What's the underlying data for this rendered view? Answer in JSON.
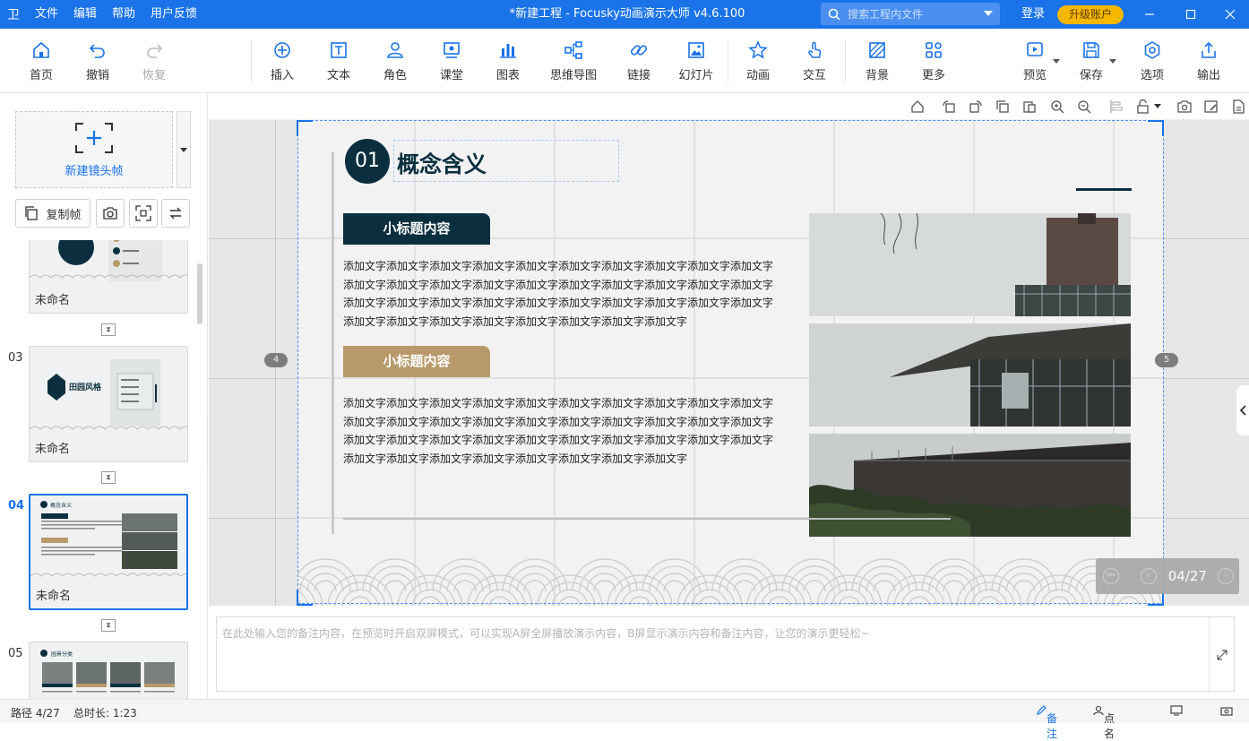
{
  "titlebar": {
    "menus": [
      "文件",
      "编辑",
      "帮助",
      "用户反馈"
    ],
    "title": "*新建工程 - Focusky动画演示大师  v4.6.100",
    "search_placeholder": "搜索工程内文件",
    "login": "登录",
    "upgrade": "升级账户",
    "accent": "#1a73e8"
  },
  "toolbar": {
    "home": "首页",
    "undo": "撤销",
    "redo": "恢复",
    "insert": "插入",
    "text": "文本",
    "role": "角色",
    "classroom": "课堂",
    "chart": "图表",
    "mindmap": "思维导图",
    "link": "链接",
    "slideshow": "幻灯片",
    "animation": "动画",
    "interaction": "交互",
    "background": "背景",
    "more": "更多",
    "preview": "预览",
    "save": "保存",
    "options": "选项",
    "export": "输出"
  },
  "sidebar": {
    "new_frame": "新建镜头帧",
    "copy_frame": "复制帧",
    "slides": [
      {
        "num": "",
        "name": "未命名"
      },
      {
        "num": "03",
        "name": "未命名",
        "thumb_title": "田园风格"
      },
      {
        "num": "04",
        "name": "未命名",
        "thumb_title": "概念含义"
      },
      {
        "num": "05",
        "name": "",
        "thumb_title": "园景分类"
      }
    ]
  },
  "slide": {
    "number": "01",
    "title": "概念含义",
    "subtitle1": "小标题内容",
    "subtitle2": "小标题内容",
    "paragraph1": "添加文字添加文字添加文字添加文字添加文字添加文字添加文字添加文字添加文字添加文字添加文字添加文字添加文字添加文字添加文字添加文字添加文字添加文字添加文字添加文字添加文字添加文字添加文字添加文字添加文字添加文字添加文字添加文字添加文字添加文字添加文字添加文字添加文字添加文字添加文字添加文字添加文字添加文字",
    "paragraph2": "添加文字添加文字添加文字添加文字添加文字添加文字添加文字添加文字添加文字添加文字添加文字添加文字添加文字添加文字添加文字添加文字添加文字添加文字添加文字添加文字添加文字添加文字添加文字添加文字添加文字添加文字添加文字添加文字添加文字添加文字添加文字添加文字添加文字添加文字添加文字添加文字添加文字添加文字",
    "prev_marker": "4",
    "next_marker": "5",
    "pager": "04/27",
    "dark_color": "#0b2f3f",
    "gold_color": "#b89a6a"
  },
  "notes": {
    "placeholder": "在此处输入您的备注内容，在预览时开启双屏模式，可以实现A屏全屏播放演示内容，B屏显示演示内容和备注内容，让您的演示更轻松~"
  },
  "status": {
    "path": "路径 4/27",
    "duration": "总时长: 1:23",
    "notes": "备注",
    "rollcall": "点名"
  }
}
